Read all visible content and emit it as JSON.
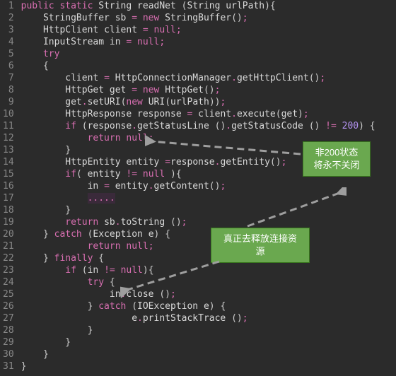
{
  "lines": [
    {
      "n": "1",
      "indent": 0,
      "tokens": [
        [
          "kw",
          "public"
        ],
        [
          "sp",
          " "
        ],
        [
          "kw",
          "static"
        ],
        [
          "sp",
          " "
        ],
        [
          "type",
          "String"
        ],
        [
          "sp",
          " "
        ],
        [
          "method",
          "readNet"
        ],
        [
          "sp",
          " "
        ],
        [
          "paren",
          "("
        ],
        [
          "type",
          "String"
        ],
        [
          "sp",
          " "
        ],
        [
          "var",
          "urlPath"
        ],
        [
          "paren",
          ")"
        ],
        [
          "brace",
          "{"
        ]
      ]
    },
    {
      "n": "2",
      "indent": 1,
      "tokens": [
        [
          "type",
          "StringBuffer"
        ],
        [
          "sp",
          " "
        ],
        [
          "var",
          "sb"
        ],
        [
          "sp",
          " "
        ],
        [
          "op",
          "="
        ],
        [
          "sp",
          " "
        ],
        [
          "kw",
          "new"
        ],
        [
          "sp",
          " "
        ],
        [
          "type",
          "StringBuffer"
        ],
        [
          "paren",
          "()"
        ],
        [
          "op",
          ";"
        ]
      ]
    },
    {
      "n": "3",
      "indent": 1,
      "tokens": [
        [
          "type",
          "HttpClient"
        ],
        [
          "sp",
          " "
        ],
        [
          "var",
          "client"
        ],
        [
          "sp",
          " "
        ],
        [
          "op",
          "="
        ],
        [
          "sp",
          " "
        ],
        [
          "kw",
          "null"
        ],
        [
          "op",
          ";"
        ]
      ]
    },
    {
      "n": "4",
      "indent": 1,
      "tokens": [
        [
          "type",
          "InputStream"
        ],
        [
          "sp",
          " "
        ],
        [
          "var",
          "in"
        ],
        [
          "sp",
          " "
        ],
        [
          "op",
          "="
        ],
        [
          "sp",
          " "
        ],
        [
          "kw",
          "null"
        ],
        [
          "op",
          ";"
        ]
      ]
    },
    {
      "n": "5",
      "indent": 1,
      "tokens": [
        [
          "kw",
          "try"
        ]
      ]
    },
    {
      "n": "6",
      "indent": 1,
      "tokens": [
        [
          "brace",
          "{"
        ]
      ]
    },
    {
      "n": "7",
      "indent": 2,
      "tokens": [
        [
          "var",
          "client"
        ],
        [
          "sp",
          " "
        ],
        [
          "op",
          "="
        ],
        [
          "sp",
          " "
        ],
        [
          "type",
          "HttpConnectionManager"
        ],
        [
          "op",
          "."
        ],
        [
          "method",
          "getHttpClient"
        ],
        [
          "paren",
          "()"
        ],
        [
          "op",
          ";"
        ]
      ]
    },
    {
      "n": "8",
      "indent": 2,
      "tokens": [
        [
          "type",
          "HttpGet"
        ],
        [
          "sp",
          " "
        ],
        [
          "var",
          "get"
        ],
        [
          "sp",
          " "
        ],
        [
          "op",
          "="
        ],
        [
          "sp",
          " "
        ],
        [
          "kw",
          "new"
        ],
        [
          "sp",
          " "
        ],
        [
          "type",
          "HttpGet"
        ],
        [
          "paren",
          "()"
        ],
        [
          "op",
          ";"
        ]
      ]
    },
    {
      "n": "9",
      "indent": 2,
      "tokens": [
        [
          "var",
          "get"
        ],
        [
          "op",
          "."
        ],
        [
          "method",
          "setURI"
        ],
        [
          "paren",
          "("
        ],
        [
          "kw",
          "new"
        ],
        [
          "sp",
          " "
        ],
        [
          "type",
          "URI"
        ],
        [
          "paren",
          "("
        ],
        [
          "var",
          "urlPath"
        ],
        [
          "paren",
          "))"
        ],
        [
          "op",
          ";"
        ]
      ]
    },
    {
      "n": "10",
      "indent": 2,
      "tokens": [
        [
          "type",
          "HttpResponse"
        ],
        [
          "sp",
          " "
        ],
        [
          "var",
          "response"
        ],
        [
          "sp",
          " "
        ],
        [
          "op",
          "="
        ],
        [
          "sp",
          " "
        ],
        [
          "var",
          "client"
        ],
        [
          "op",
          "."
        ],
        [
          "method",
          "execute"
        ],
        [
          "paren",
          "("
        ],
        [
          "var",
          "get"
        ],
        [
          "paren",
          ")"
        ],
        [
          "op",
          ";"
        ]
      ]
    },
    {
      "n": "11",
      "indent": 2,
      "tokens": [
        [
          "kw",
          "if"
        ],
        [
          "sp",
          " "
        ],
        [
          "paren",
          "("
        ],
        [
          "var",
          "response"
        ],
        [
          "op",
          "."
        ],
        [
          "method",
          "getStatusLine"
        ],
        [
          "sp",
          " "
        ],
        [
          "paren",
          "()"
        ],
        [
          "op",
          "."
        ],
        [
          "method",
          "getStatusCode"
        ],
        [
          "sp",
          " "
        ],
        [
          "paren",
          "()"
        ],
        [
          "sp",
          " "
        ],
        [
          "op",
          "!="
        ],
        [
          "sp",
          " "
        ],
        [
          "num200",
          "200"
        ],
        [
          "paren",
          ")"
        ],
        [
          "sp",
          " "
        ],
        [
          "brace",
          "{"
        ]
      ]
    },
    {
      "n": "12",
      "indent": 3,
      "tokens": [
        [
          "kw",
          "return"
        ],
        [
          "sp",
          " "
        ],
        [
          "kw",
          "null"
        ],
        [
          "op",
          ";"
        ]
      ]
    },
    {
      "n": "13",
      "indent": 2,
      "tokens": [
        [
          "brace",
          "}"
        ]
      ]
    },
    {
      "n": "14",
      "indent": 2,
      "tokens": [
        [
          "type",
          "HttpEntity"
        ],
        [
          "sp",
          " "
        ],
        [
          "var",
          "entity"
        ],
        [
          "sp",
          " "
        ],
        [
          "op",
          "="
        ],
        [
          "var",
          "response"
        ],
        [
          "op",
          "."
        ],
        [
          "method",
          "getEntity"
        ],
        [
          "paren",
          "()"
        ],
        [
          "op",
          ";"
        ]
      ]
    },
    {
      "n": "15",
      "indent": 2,
      "tokens": [
        [
          "kw",
          "if"
        ],
        [
          "paren",
          "("
        ],
        [
          "sp",
          " "
        ],
        [
          "var",
          "entity"
        ],
        [
          "sp",
          " "
        ],
        [
          "op",
          "!="
        ],
        [
          "sp",
          " "
        ],
        [
          "kw",
          "null"
        ],
        [
          "sp",
          " "
        ],
        [
          "paren",
          ")"
        ],
        [
          "brace",
          "{"
        ]
      ]
    },
    {
      "n": "16",
      "indent": 3,
      "tokens": [
        [
          "var",
          "in"
        ],
        [
          "sp",
          " "
        ],
        [
          "op",
          "="
        ],
        [
          "sp",
          " "
        ],
        [
          "var",
          "entity"
        ],
        [
          "op",
          "."
        ],
        [
          "method",
          "getContent"
        ],
        [
          "paren",
          "()"
        ],
        [
          "op",
          ";"
        ]
      ]
    },
    {
      "n": "17",
      "indent": 3,
      "tokens": [
        [
          "dots",
          "....."
        ]
      ]
    },
    {
      "n": "18",
      "indent": 2,
      "tokens": [
        [
          "brace",
          "}"
        ]
      ]
    },
    {
      "n": "19",
      "indent": 2,
      "tokens": [
        [
          "kw",
          "return"
        ],
        [
          "sp",
          " "
        ],
        [
          "var",
          "sb"
        ],
        [
          "op",
          "."
        ],
        [
          "method",
          "toString"
        ],
        [
          "sp",
          " "
        ],
        [
          "paren",
          "()"
        ],
        [
          "op",
          ";"
        ]
      ]
    },
    {
      "n": "20",
      "indent": 1,
      "tokens": [
        [
          "brace",
          "}"
        ],
        [
          "sp",
          " "
        ],
        [
          "kw",
          "catch"
        ],
        [
          "sp",
          " "
        ],
        [
          "paren",
          "("
        ],
        [
          "type",
          "Exception"
        ],
        [
          "sp",
          " "
        ],
        [
          "var",
          "e"
        ],
        [
          "paren",
          ")"
        ],
        [
          "sp",
          " "
        ],
        [
          "brace",
          "{"
        ]
      ]
    },
    {
      "n": "21",
      "indent": 3,
      "tokens": [
        [
          "kw",
          "return"
        ],
        [
          "sp",
          " "
        ],
        [
          "kw",
          "null"
        ],
        [
          "op",
          ";"
        ]
      ]
    },
    {
      "n": "22",
      "indent": 1,
      "tokens": [
        [
          "brace",
          "}"
        ],
        [
          "sp",
          " "
        ],
        [
          "kw",
          "finally"
        ],
        [
          "sp",
          " "
        ],
        [
          "brace",
          "{"
        ]
      ]
    },
    {
      "n": "23",
      "indent": 2,
      "tokens": [
        [
          "kw",
          "if"
        ],
        [
          "sp",
          " "
        ],
        [
          "paren",
          "("
        ],
        [
          "var",
          "in"
        ],
        [
          "sp",
          " "
        ],
        [
          "op",
          "!="
        ],
        [
          "sp",
          " "
        ],
        [
          "kw",
          "null"
        ],
        [
          "paren",
          ")"
        ],
        [
          "brace",
          "{"
        ]
      ]
    },
    {
      "n": "24",
      "indent": 3,
      "tokens": [
        [
          "kw",
          "try"
        ],
        [
          "sp",
          " "
        ],
        [
          "brace",
          "{"
        ]
      ]
    },
    {
      "n": "25",
      "indent": 4,
      "tokens": [
        [
          "var",
          "in"
        ],
        [
          "op",
          "."
        ],
        [
          "method",
          "close"
        ],
        [
          "sp",
          " "
        ],
        [
          "paren",
          "()"
        ],
        [
          "op",
          ";"
        ]
      ]
    },
    {
      "n": "26",
      "indent": 3,
      "tokens": [
        [
          "brace",
          "}"
        ],
        [
          "sp",
          " "
        ],
        [
          "kw",
          "catch"
        ],
        [
          "sp",
          " "
        ],
        [
          "paren",
          "("
        ],
        [
          "type",
          "IOException"
        ],
        [
          "sp",
          " "
        ],
        [
          "var",
          "e"
        ],
        [
          "paren",
          ")"
        ],
        [
          "sp",
          " "
        ],
        [
          "brace",
          "{"
        ]
      ]
    },
    {
      "n": "27",
      "indent": 5,
      "tokens": [
        [
          "var",
          "e"
        ],
        [
          "op",
          "."
        ],
        [
          "method",
          "printStackTrace"
        ],
        [
          "sp",
          " "
        ],
        [
          "paren",
          "()"
        ],
        [
          "op",
          ";"
        ]
      ]
    },
    {
      "n": "28",
      "indent": 3,
      "tokens": [
        [
          "brace",
          "}"
        ]
      ]
    },
    {
      "n": "29",
      "indent": 2,
      "tokens": [
        [
          "brace",
          "}"
        ]
      ]
    },
    {
      "n": "30",
      "indent": 1,
      "tokens": [
        [
          "brace",
          "}"
        ]
      ]
    },
    {
      "n": "31",
      "indent": 0,
      "tokens": [
        [
          "brace",
          "}"
        ]
      ]
    }
  ],
  "annotation1": {
    "line1": "非200状态",
    "line2": "将永不关闭"
  },
  "annotation2": {
    "line1": "真正去释放连接资",
    "line2": "源"
  },
  "colors": {
    "keyword": "#d96fb2",
    "background": "#2b2b2b",
    "gutter": "#888",
    "annot_bg": "#6aa84f",
    "annot_border": "#38761d",
    "num200": "#b392f0"
  }
}
